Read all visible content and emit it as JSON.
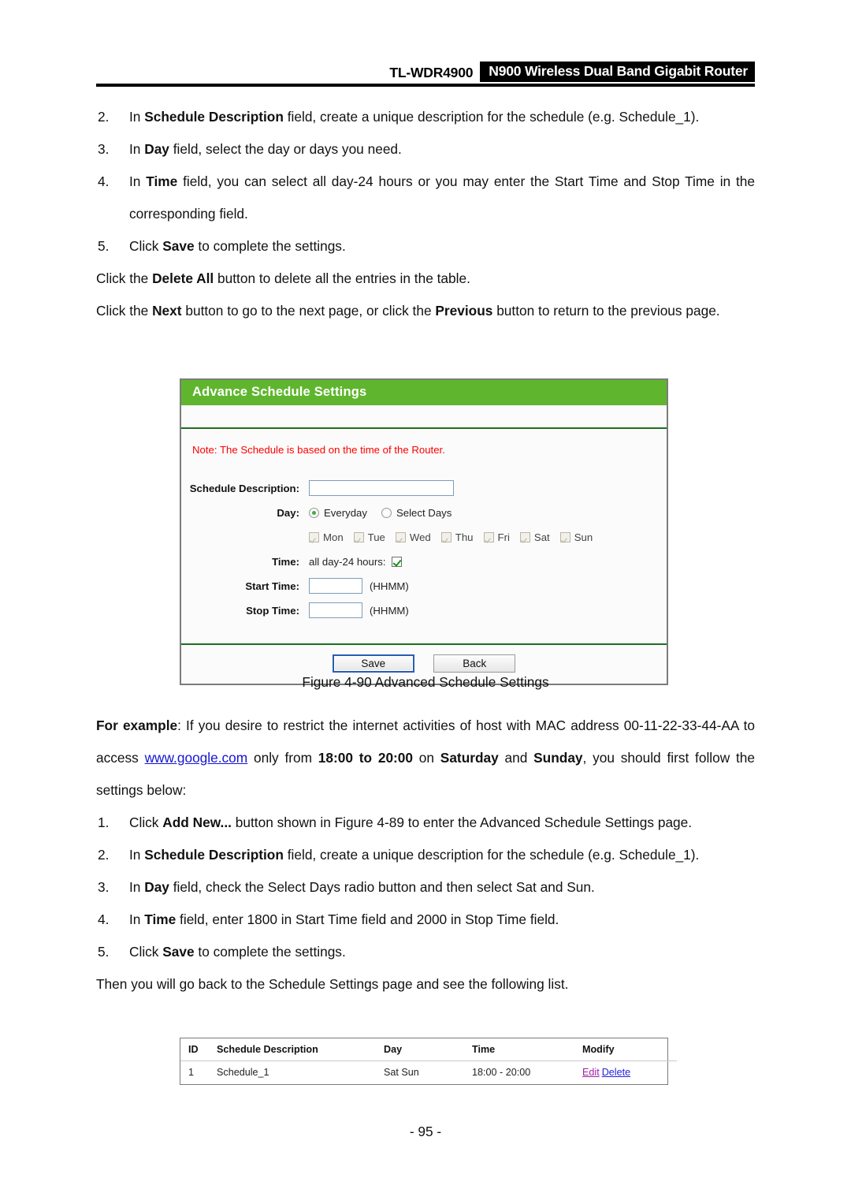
{
  "header": {
    "model": "TL-WDR4900",
    "product": "N900 Wireless Dual Band Gigabit Router"
  },
  "top_steps": [
    {
      "num": "2.",
      "segments": [
        {
          "t": "In ",
          "b": false
        },
        {
          "t": "Schedule Description",
          "b": true
        },
        {
          "t": " field, create a unique description for the schedule (e.g. Schedule_1).",
          "b": false
        }
      ]
    },
    {
      "num": "3.",
      "segments": [
        {
          "t": "In ",
          "b": false
        },
        {
          "t": "Day",
          "b": true
        },
        {
          "t": " field, select the day or days you need.",
          "b": false
        }
      ]
    },
    {
      "num": "4.",
      "segments": [
        {
          "t": "In ",
          "b": false
        },
        {
          "t": "Time",
          "b": true
        },
        {
          "t": " field, you can select all day-24 hours or you may enter the Start Time and Stop Time in the corresponding field.",
          "b": false
        }
      ]
    },
    {
      "num": "5.",
      "segments": [
        {
          "t": "Click ",
          "b": false
        },
        {
          "t": "Save",
          "b": true
        },
        {
          "t": " to complete the settings.",
          "b": false
        }
      ]
    }
  ],
  "paragraphs_mid": [
    {
      "segments": [
        {
          "t": "Click the ",
          "b": false
        },
        {
          "t": "Delete All",
          "b": true
        },
        {
          "t": " button to delete all the entries in the table.",
          "b": false
        }
      ]
    },
    {
      "segments": [
        {
          "t": "Click the ",
          "b": false
        },
        {
          "t": "Next",
          "b": true
        },
        {
          "t": " button to go to the next page, or click the ",
          "b": false
        },
        {
          "t": "Previous",
          "b": true
        },
        {
          "t": " button to return to the previous page.",
          "b": false
        }
      ]
    }
  ],
  "router_panel": {
    "title": "Advance Schedule Settings",
    "note": "Note: The Schedule is based on the time of the Router.",
    "fields": {
      "schedule_description_label": "Schedule Description:",
      "schedule_description_value": "",
      "day_label": "Day:",
      "radio_everyday": "Everyday",
      "radio_select_days": "Select Days",
      "radio_selected": "Everyday",
      "days": [
        {
          "label": "Mon",
          "checked": true,
          "enabled": false
        },
        {
          "label": "Tue",
          "checked": true,
          "enabled": false
        },
        {
          "label": "Wed",
          "checked": true,
          "enabled": false
        },
        {
          "label": "Thu",
          "checked": true,
          "enabled": false
        },
        {
          "label": "Fri",
          "checked": true,
          "enabled": false
        },
        {
          "label": "Sat",
          "checked": true,
          "enabled": false
        },
        {
          "label": "Sun",
          "checked": true,
          "enabled": false
        }
      ],
      "time_label": "Time:",
      "all_day_label": "all day-24 hours:",
      "all_day_checked": true,
      "start_time_label": "Start Time:",
      "start_time_value": "",
      "start_time_hint": "(HHMM)",
      "stop_time_label": "Stop Time:",
      "stop_time_value": "",
      "stop_time_hint": "(HHMM)"
    },
    "buttons": {
      "save": "Save",
      "back": "Back"
    },
    "colors": {
      "title_bar_green": "#5fb62e",
      "note_red": "#ff0000",
      "divider_green": "#1f6d1f"
    }
  },
  "figure_caption": "Figure 4-90 Advanced Schedule Settings",
  "example_paragraph": {
    "segments": [
      {
        "t": "For example",
        "b": true
      },
      {
        "t": ": If you desire to restrict the internet activities of host with MAC address 00-11-22-33-44-AA to access ",
        "b": false
      },
      {
        "t": "www.google.com",
        "b": false,
        "link": true
      },
      {
        "t": " only from ",
        "b": false
      },
      {
        "t": "18:00 to 20:00",
        "b": true
      },
      {
        "t": " on ",
        "b": false
      },
      {
        "t": "Saturday",
        "b": true
      },
      {
        "t": " and ",
        "b": false
      },
      {
        "t": "Sunday",
        "b": true
      },
      {
        "t": ", you should first follow the settings below:",
        "b": false
      }
    ]
  },
  "example_steps": [
    {
      "num": "1.",
      "segments": [
        {
          "t": "Click ",
          "b": false
        },
        {
          "t": "Add New...",
          "b": true
        },
        {
          "t": " button shown in Figure 4-89 to enter the Advanced Schedule Settings page.",
          "b": false
        }
      ]
    },
    {
      "num": "2.",
      "segments": [
        {
          "t": "In ",
          "b": false
        },
        {
          "t": "Schedule Description",
          "b": true
        },
        {
          "t": " field, create a unique description for the schedule (e.g. Schedule_1).",
          "b": false
        }
      ]
    },
    {
      "num": "3.",
      "segments": [
        {
          "t": "In ",
          "b": false
        },
        {
          "t": "Day",
          "b": true
        },
        {
          "t": " field, check the Select Days radio button and then select Sat and Sun.",
          "b": false
        }
      ]
    },
    {
      "num": "4.",
      "segments": [
        {
          "t": "In ",
          "b": false
        },
        {
          "t": "Time",
          "b": true
        },
        {
          "t": " field, enter 1800 in Start Time field and 2000 in Stop Time field.",
          "b": false
        }
      ]
    },
    {
      "num": "5.",
      "segments": [
        {
          "t": "Click ",
          "b": false
        },
        {
          "t": "Save",
          "b": true
        },
        {
          "t": " to complete the settings.",
          "b": false
        }
      ]
    }
  ],
  "closing_paragraph": {
    "segments": [
      {
        "t": "Then you will go back to the Schedule Settings page and see the following list.",
        "b": false
      }
    ]
  },
  "schedule_table": {
    "columns": [
      "ID",
      "Schedule Description",
      "Day",
      "Time",
      "Modify"
    ],
    "rows": [
      {
        "id": "1",
        "description": "Schedule_1",
        "day": "Sat Sun",
        "time": "18:00 - 20:00",
        "edit": "Edit",
        "delete": "Delete"
      }
    ]
  },
  "page_number": "- 95 -"
}
